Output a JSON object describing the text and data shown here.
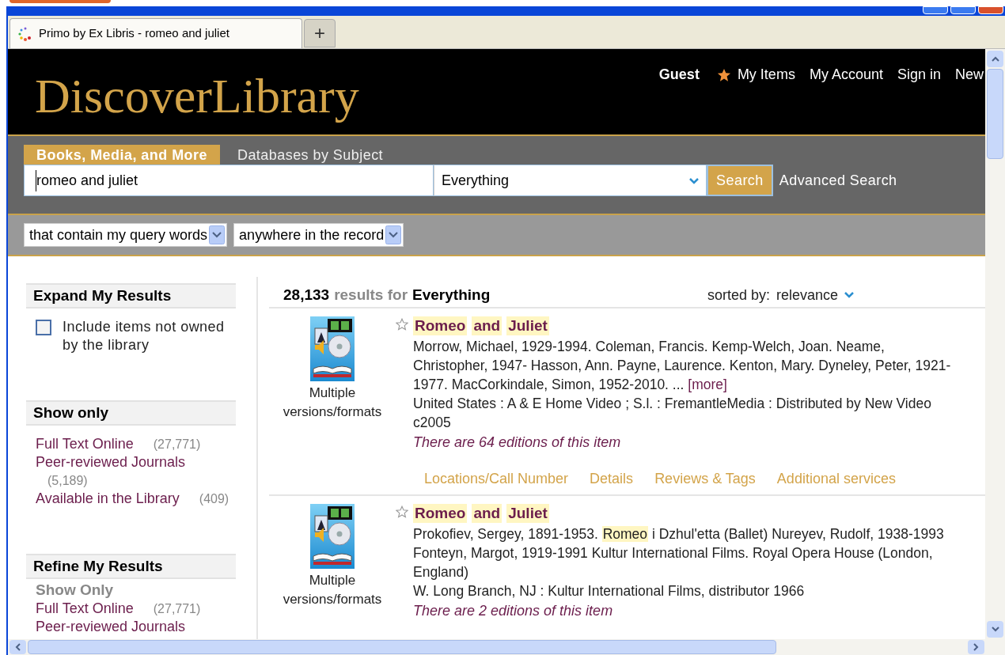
{
  "browser": {
    "tabs": [
      {
        "title": "Primo by Ex Libris - romeo and juliet",
        "selected": true
      }
    ],
    "new_tab_button": "+"
  },
  "header": {
    "logo": "DiscoverLibrary",
    "user": "Guest",
    "links": [
      "My Items",
      "My Account",
      "Sign in",
      "New"
    ]
  },
  "search": {
    "tabs": [
      {
        "label": "Books, Media, and More",
        "selected": true
      },
      {
        "label": "Databases by Subject",
        "selected": false
      }
    ],
    "query": "romeo and juliet",
    "scope": "Everything",
    "button": "Search",
    "advanced": "Advanced Search"
  },
  "filters": [
    "that contain my query words",
    "anywhere in the record"
  ],
  "sidebar": {
    "sections": [
      {
        "kind": "checkbox",
        "title": "Expand My Results",
        "label": "Include items not owned by the library",
        "checked": false
      },
      {
        "kind": "facets",
        "title": "Show only",
        "items": [
          {
            "label": "Full Text Online",
            "count": "(27,771)"
          },
          {
            "label": "Peer-reviewed Journals",
            "count": "(5,189)"
          },
          {
            "label": "Available in the Library",
            "count": "(409)"
          }
        ]
      },
      {
        "kind": "refine",
        "title": "Refine My Results",
        "subtitle": "Show Only",
        "items": [
          {
            "label": "Full Text Online",
            "count": "(27,771)"
          },
          {
            "label": "Peer-reviewed Journals"
          }
        ]
      }
    ]
  },
  "results": {
    "count": "28,133",
    "label": "results for",
    "scope": "Everything",
    "sort_label": "sorted by:",
    "sort_value": "relevance",
    "records": [
      {
        "format": "Multiple versions/formats",
        "title": [
          {
            "text": "Romeo",
            "highlighted": true
          },
          {
            "text": "and",
            "highlighted": true
          },
          {
            "text": "Juliet",
            "highlighted": true
          }
        ],
        "authors": [
          {
            "text": "Morrow, Michael, 1929-1994. Coleman, Francis. Kemp-Welch, Joan. Neame, Christopher, 1947- Hasson, Ann. Payne, Laurence. Kenton, Mary. Dyneley, Peter, 1921-1977. MacCorkindale, Simon, 1952-2010. ...",
            "highlighted": false
          }
        ],
        "more": "[more]",
        "publisher": "United States : A & E Home Video ; S.l. : FremantleMedia : Distributed by New Video c2005",
        "editions": "There are 64 editions of this item",
        "tabs": [
          "Locations/Call Number",
          "Details",
          "Reviews & Tags",
          "Additional services"
        ]
      },
      {
        "format": "Multiple versions/formats",
        "title": [
          {
            "text": "Romeo",
            "highlighted": true
          },
          {
            "text": "and",
            "highlighted": true
          },
          {
            "text": "Juliet",
            "highlighted": true
          }
        ],
        "authors": [
          {
            "text": "Prokofiev, Sergey, 1891-1953. ",
            "highlighted": false
          },
          {
            "text": "Romeo",
            "highlighted": true
          },
          {
            "text": " i Dzhulʹetta (Ballet) Nureyev, Rudolf, 1938-1993 Fonteyn, Margot, 1919-1991 Kultur International Films. Royal Opera House (London, England)",
            "highlighted": false
          }
        ],
        "publisher": "W. Long Branch, NJ : Kultur International Films, distributor 1966",
        "editions": "There are 2 editions of this item"
      }
    ]
  }
}
